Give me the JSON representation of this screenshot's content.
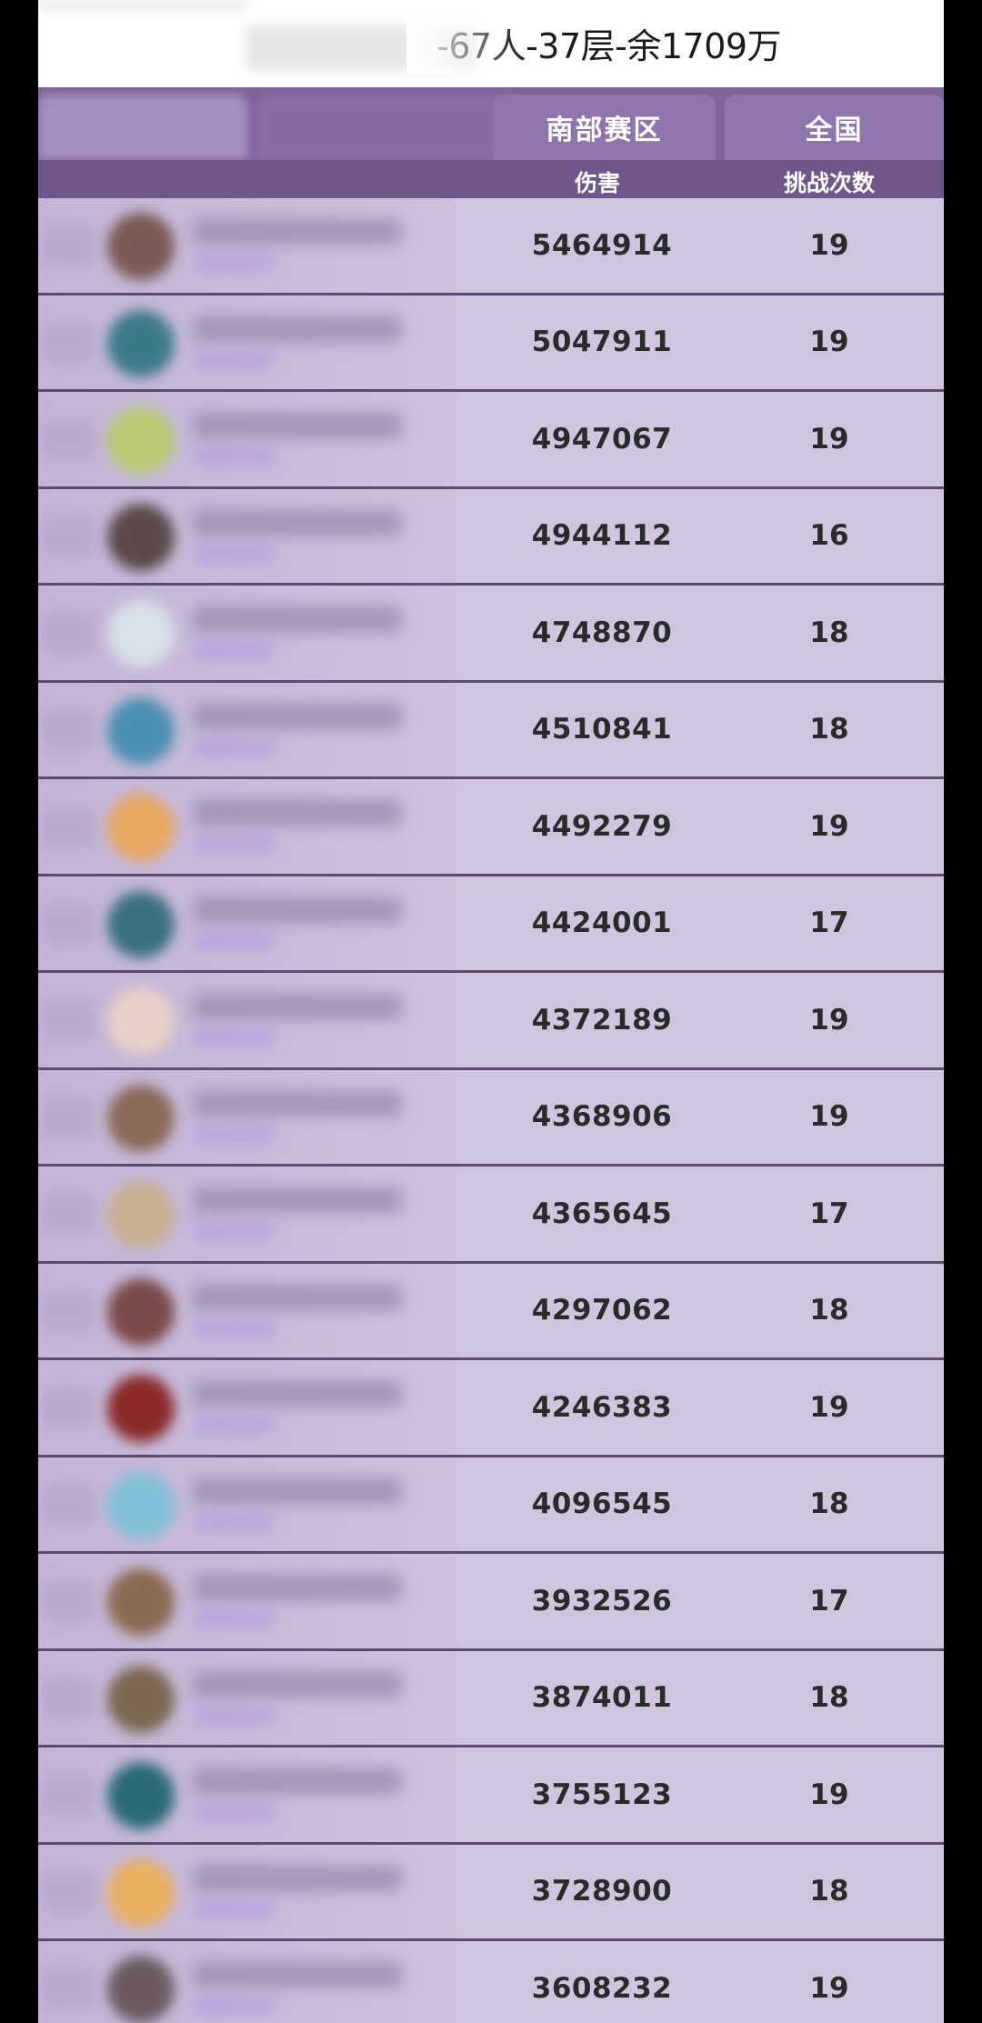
{
  "header": {
    "title_suffix": "-67人-37层-余1709万"
  },
  "tabs": [
    {
      "label": "南部赛区"
    },
    {
      "label": "全国"
    }
  ],
  "columns": {
    "damage": "伤害",
    "attempts": "挑战次数"
  },
  "rows": [
    {
      "damage": "5464914",
      "attempts": "19",
      "avatar_color": "#7a5a52"
    },
    {
      "damage": "5047911",
      "attempts": "19",
      "avatar_color": "#3c7a8a"
    },
    {
      "damage": "4947067",
      "attempts": "19",
      "avatar_color": "#b8c870"
    },
    {
      "damage": "4944112",
      "attempts": "16",
      "avatar_color": "#5a4a4a"
    },
    {
      "damage": "4748870",
      "attempts": "18",
      "avatar_color": "#d8e0e8"
    },
    {
      "damage": "4510841",
      "attempts": "18",
      "avatar_color": "#4a90b0"
    },
    {
      "damage": "4492279",
      "attempts": "19",
      "avatar_color": "#e8a860"
    },
    {
      "damage": "4424001",
      "attempts": "17",
      "avatar_color": "#3a7080"
    },
    {
      "damage": "4372189",
      "attempts": "19",
      "avatar_color": "#e8d0c8"
    },
    {
      "damage": "4368906",
      "attempts": "19",
      "avatar_color": "#8a6a58"
    },
    {
      "damage": "4365645",
      "attempts": "17",
      "avatar_color": "#c8b090"
    },
    {
      "damage": "4297062",
      "attempts": "18",
      "avatar_color": "#7a4a48"
    },
    {
      "damage": "4246383",
      "attempts": "19",
      "avatar_color": "#8a2a28"
    },
    {
      "damage": "4096545",
      "attempts": "18",
      "avatar_color": "#80c0d8"
    },
    {
      "damage": "3932526",
      "attempts": "17",
      "avatar_color": "#8a6a50"
    },
    {
      "damage": "3874011",
      "attempts": "18",
      "avatar_color": "#7a6850"
    },
    {
      "damage": "3755123",
      "attempts": "19",
      "avatar_color": "#2a6a78"
    },
    {
      "damage": "3728900",
      "attempts": "18",
      "avatar_color": "#e8b060"
    },
    {
      "damage": "3608232",
      "attempts": "19",
      "avatar_color": "#6a5a60"
    }
  ]
}
